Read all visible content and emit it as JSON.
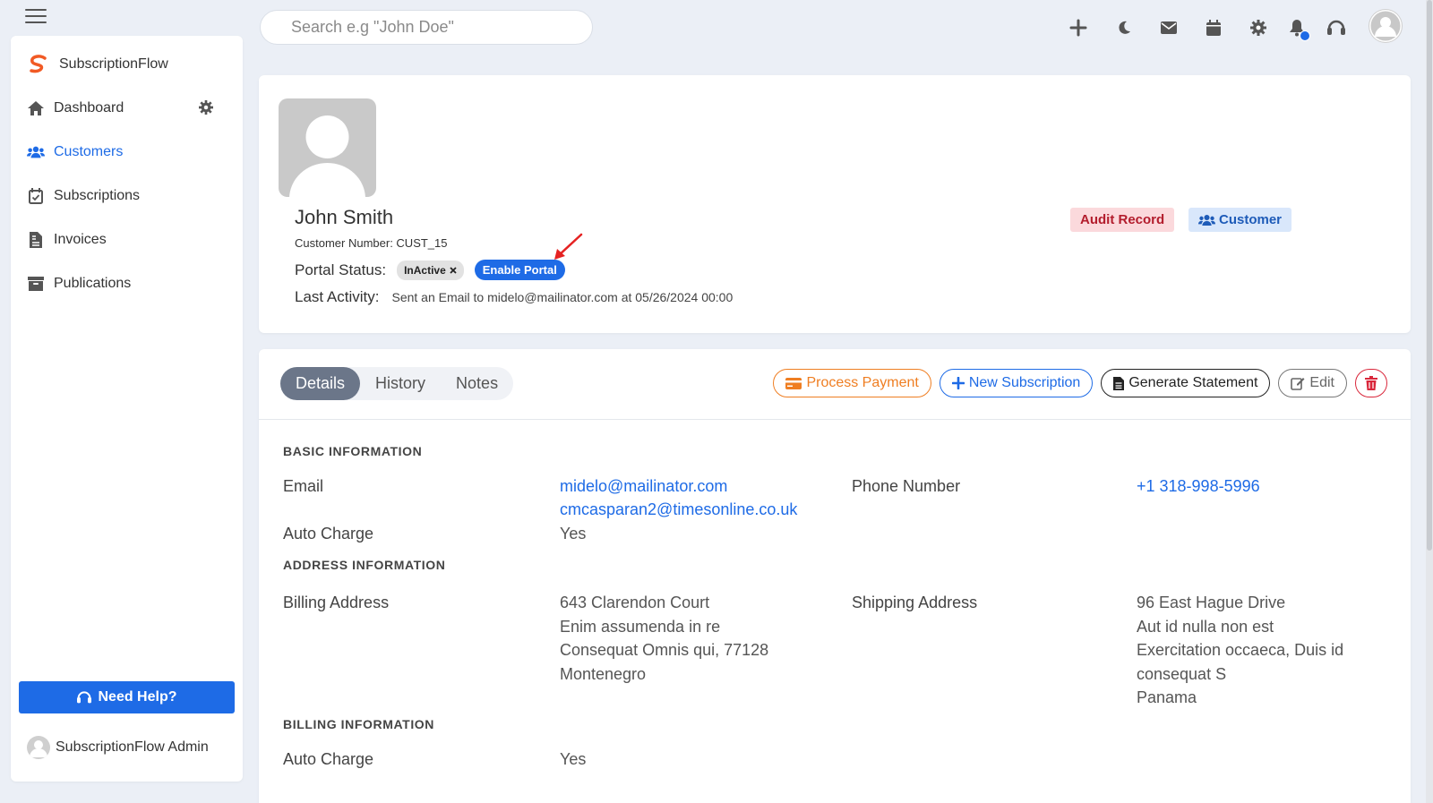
{
  "search": {
    "placeholder": "Search e.g \"John Doe\""
  },
  "brand": {
    "name": "SubscriptionFlow"
  },
  "sidebar": {
    "items": [
      {
        "label": "Dashboard",
        "icon": "home-icon"
      },
      {
        "label": "Customers",
        "icon": "users-icon",
        "active": true
      },
      {
        "label": "Subscriptions",
        "icon": "calendar-check-icon"
      },
      {
        "label": "Invoices",
        "icon": "invoice-icon"
      },
      {
        "label": "Publications",
        "icon": "archive-icon"
      }
    ],
    "help_label": "Need Help?",
    "admin_name": "SubscriptionFlow Admin"
  },
  "profile": {
    "name": "John Smith",
    "customer_number": "Customer Number: CUST_15",
    "portal_label": "Portal Status:",
    "portal_status": "InActive",
    "enable_portal_label": "Enable Portal",
    "last_activity_label": "Last Activity:",
    "last_activity_value": "Sent an Email to midelo@mailinator.com at 05/26/2024 00:00",
    "audit_label": "Audit Record",
    "type_label": "Customer"
  },
  "tabs": [
    {
      "label": "Details",
      "active": true
    },
    {
      "label": "History"
    },
    {
      "label": "Notes"
    }
  ],
  "actions": {
    "process_payment": "Process Payment",
    "new_subscription": "New Subscription",
    "generate_statement": "Generate Statement",
    "edit": "Edit"
  },
  "details": {
    "basic_title": "BASIC INFORMATION",
    "email_label": "Email",
    "email_1": "midelo@mailinator.com",
    "email_2": "cmcasparan2@timesonline.co.uk",
    "phone_label": "Phone Number",
    "phone_value": "+1 318-998-5996",
    "auto_charge_label": "Auto Charge",
    "auto_charge_value": "Yes",
    "address_title": "ADDRESS INFORMATION",
    "billing_address_label": "Billing Address",
    "billing_address": [
      "643 Clarendon Court",
      "Enim assumenda in re",
      "Consequat Omnis qui, 77128",
      "Montenegro"
    ],
    "shipping_address_label": "Shipping Address",
    "shipping_address": [
      "96 East Hague Drive",
      "Aut id nulla non est",
      "Exercitation occaeca, Duis id",
      "consequat S",
      "Panama"
    ],
    "billing_title": "BILLING INFORMATION",
    "billing_auto_charge_label": "Auto Charge",
    "billing_auto_charge_value": "Yes"
  },
  "colors": {
    "primary": "#1e6be6",
    "orange": "#ef7e22",
    "danger": "#d9273b",
    "audit_bg": "#fbd9dc",
    "customer_bg": "#d9e7fb"
  }
}
